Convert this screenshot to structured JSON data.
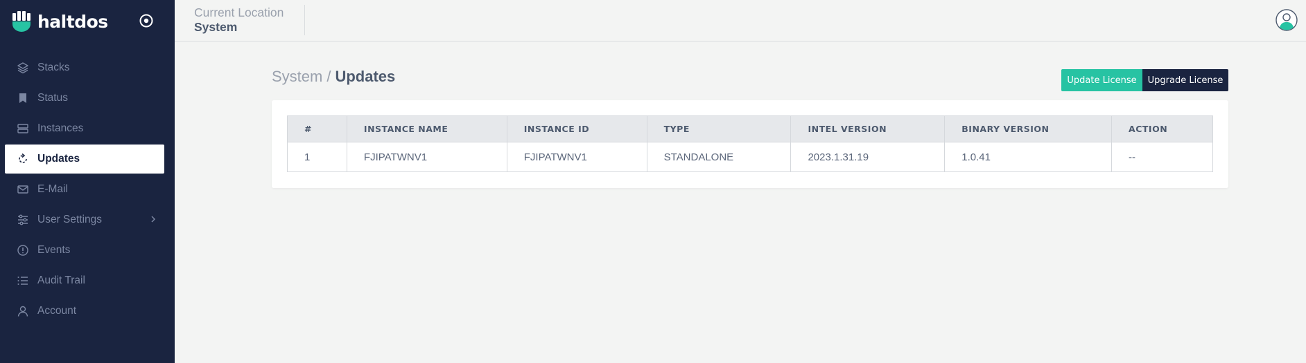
{
  "brand": {
    "name": "haltdos"
  },
  "sidebar": {
    "items": [
      {
        "label": "Stacks",
        "icon": "layers-icon"
      },
      {
        "label": "Status",
        "icon": "bookmark-icon"
      },
      {
        "label": "Instances",
        "icon": "server-icon"
      },
      {
        "label": "Updates",
        "icon": "refresh-icon",
        "active": true
      },
      {
        "label": "E-Mail",
        "icon": "mail-icon"
      },
      {
        "label": "User Settings",
        "icon": "sliders-icon",
        "has_submenu": true
      },
      {
        "label": "Events",
        "icon": "alert-circle-icon"
      },
      {
        "label": "Audit Trail",
        "icon": "list-icon"
      },
      {
        "label": "Account",
        "icon": "user-icon"
      }
    ]
  },
  "header": {
    "location_label": "Current Location",
    "location_value": "System"
  },
  "breadcrumb": {
    "parent": "System",
    "separator": "/",
    "current": "Updates"
  },
  "actions": {
    "update_license": "Update License",
    "upgrade_license": "Upgrade License"
  },
  "table": {
    "columns": [
      "#",
      "INSTANCE NAME",
      "INSTANCE ID",
      "TYPE",
      "INTEL VERSION",
      "BINARY VERSION",
      "ACTION"
    ],
    "rows": [
      [
        "1",
        "FJIPATWNV1",
        "FJIPATWNV1",
        "STANDALONE",
        "2023.1.31.19",
        "1.0.41",
        "--"
      ]
    ]
  },
  "colors": {
    "sidebar_bg": "#1a2440",
    "accent": "#27c3a3",
    "page_bg": "#f3f4f3"
  }
}
